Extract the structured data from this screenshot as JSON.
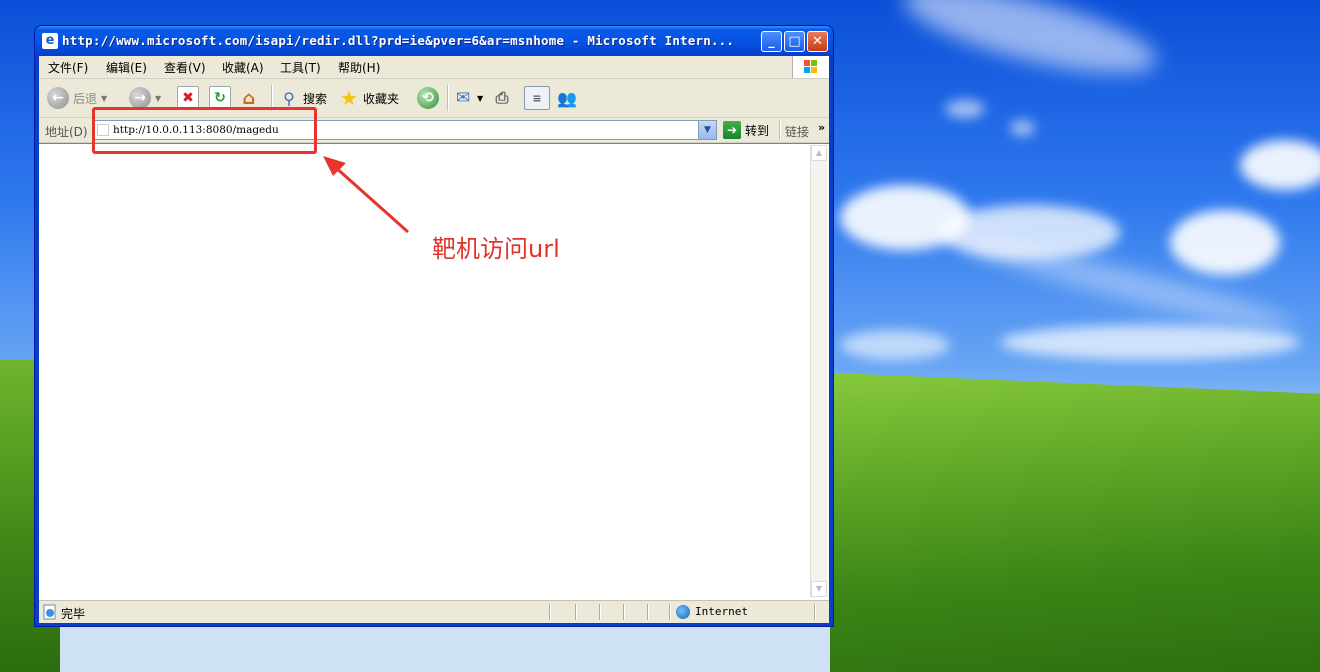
{
  "window": {
    "title": "http://www.microsoft.com/isapi/redir.dll?prd=ie&pver=6&ar=msnhome - Microsoft Intern...",
    "controls": {
      "minimize": "_",
      "maximize": "□",
      "close": "✕"
    }
  },
  "menu": {
    "items": [
      "文件(F)",
      "编辑(E)",
      "查看(V)",
      "收藏(A)",
      "工具(T)",
      "帮助(H)"
    ]
  },
  "toolbar": {
    "back_label": "后退",
    "search_label": "搜索",
    "favorites_label": "收藏夹"
  },
  "address": {
    "label": "地址(D)",
    "url": "http://10.0.0.113:8080/magedu",
    "go_label": "转到",
    "links_label": "链接",
    "chevron": "»"
  },
  "status": {
    "text": "完毕",
    "zone": "Internet"
  },
  "annotation": {
    "text": "靶机访问url",
    "color": "#e0332b"
  }
}
